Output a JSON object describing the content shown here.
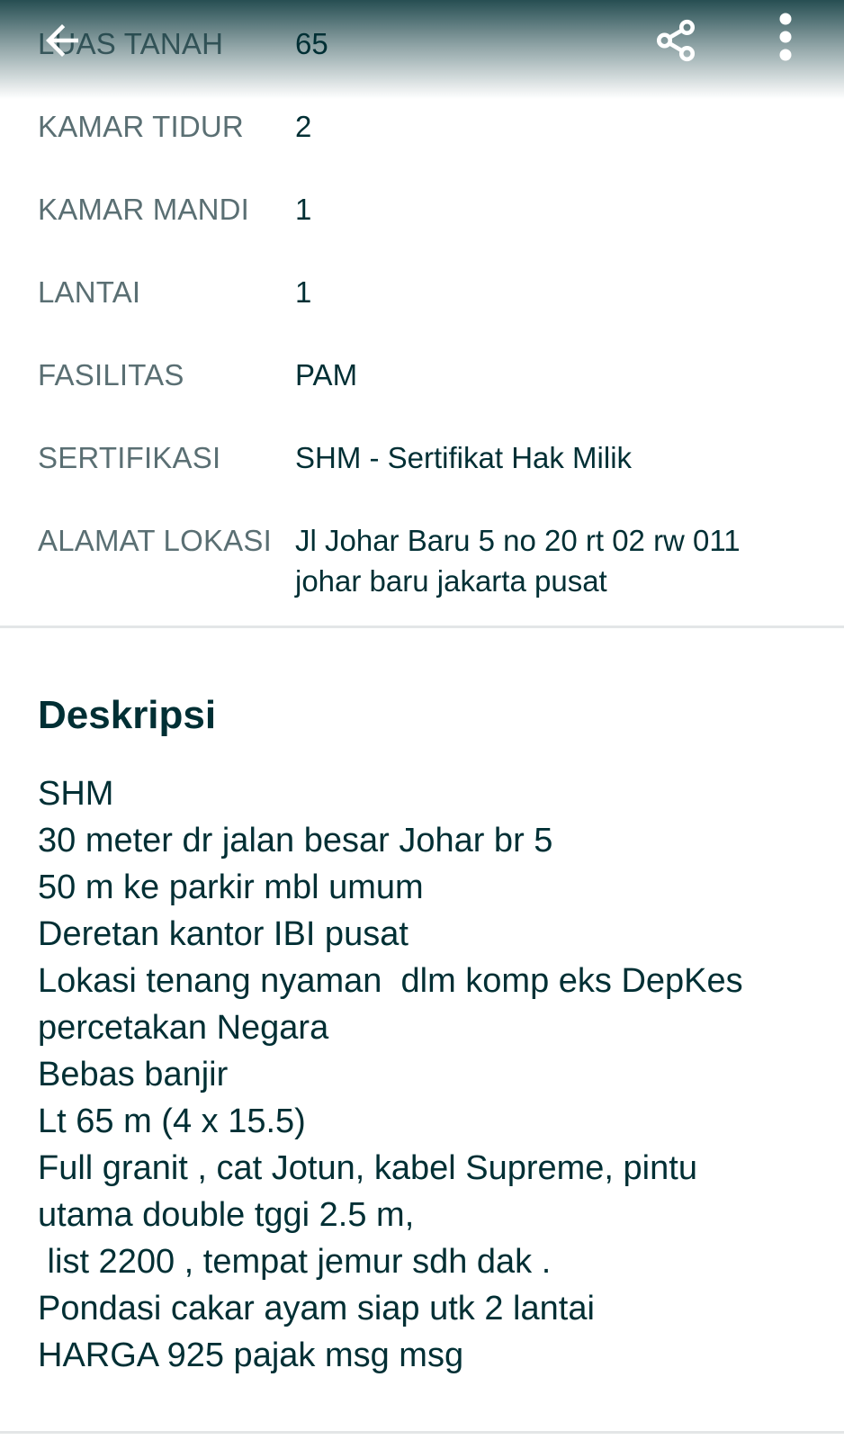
{
  "app_bar": {
    "back_icon": "arrow-left-icon",
    "share_icon": "share-icon",
    "more_icon": "more-vertical-icon"
  },
  "details": [
    {
      "label": "LUAS TANAH",
      "value": "65"
    },
    {
      "label": "KAMAR TIDUR",
      "value": "2"
    },
    {
      "label": "KAMAR MANDI",
      "value": "1"
    },
    {
      "label": "LANTAI",
      "value": "1"
    },
    {
      "label": "FASILITAS",
      "value": "PAM"
    },
    {
      "label": "SERTIFIKASI",
      "value": "SHM - Sertifikat Hak Milik"
    },
    {
      "label": "ALAMAT LOKASI",
      "value": "Jl Johar Baru 5 no 20 rt 02 rw 011 johar baru jakarta pusat"
    }
  ],
  "description": {
    "title": "Deskripsi",
    "lines": [
      "SHM",
      "30 meter dr jalan besar Johar br 5",
      "50 m ke parkir mbl umum",
      "Deretan kantor IBI pusat",
      "Lokasi tenang nyaman  dlm komp eks DepKes",
      "percetakan Negara",
      "Bebas banjir",
      "Lt 65 m (4 x 15.5)",
      "Full granit , cat Jotun, kabel Supreme, pintu",
      "utama double tggi 2.5 m,",
      " list 2200 , tempat jemur sdh dak .",
      "Pondasi cakar ayam siap utk 2 lantai",
      "HARGA 925 pajak msg msg"
    ]
  },
  "colors": {
    "primary_text": "#002f34",
    "label_text": "#5a6f73",
    "divider": "#e3e6e7"
  }
}
